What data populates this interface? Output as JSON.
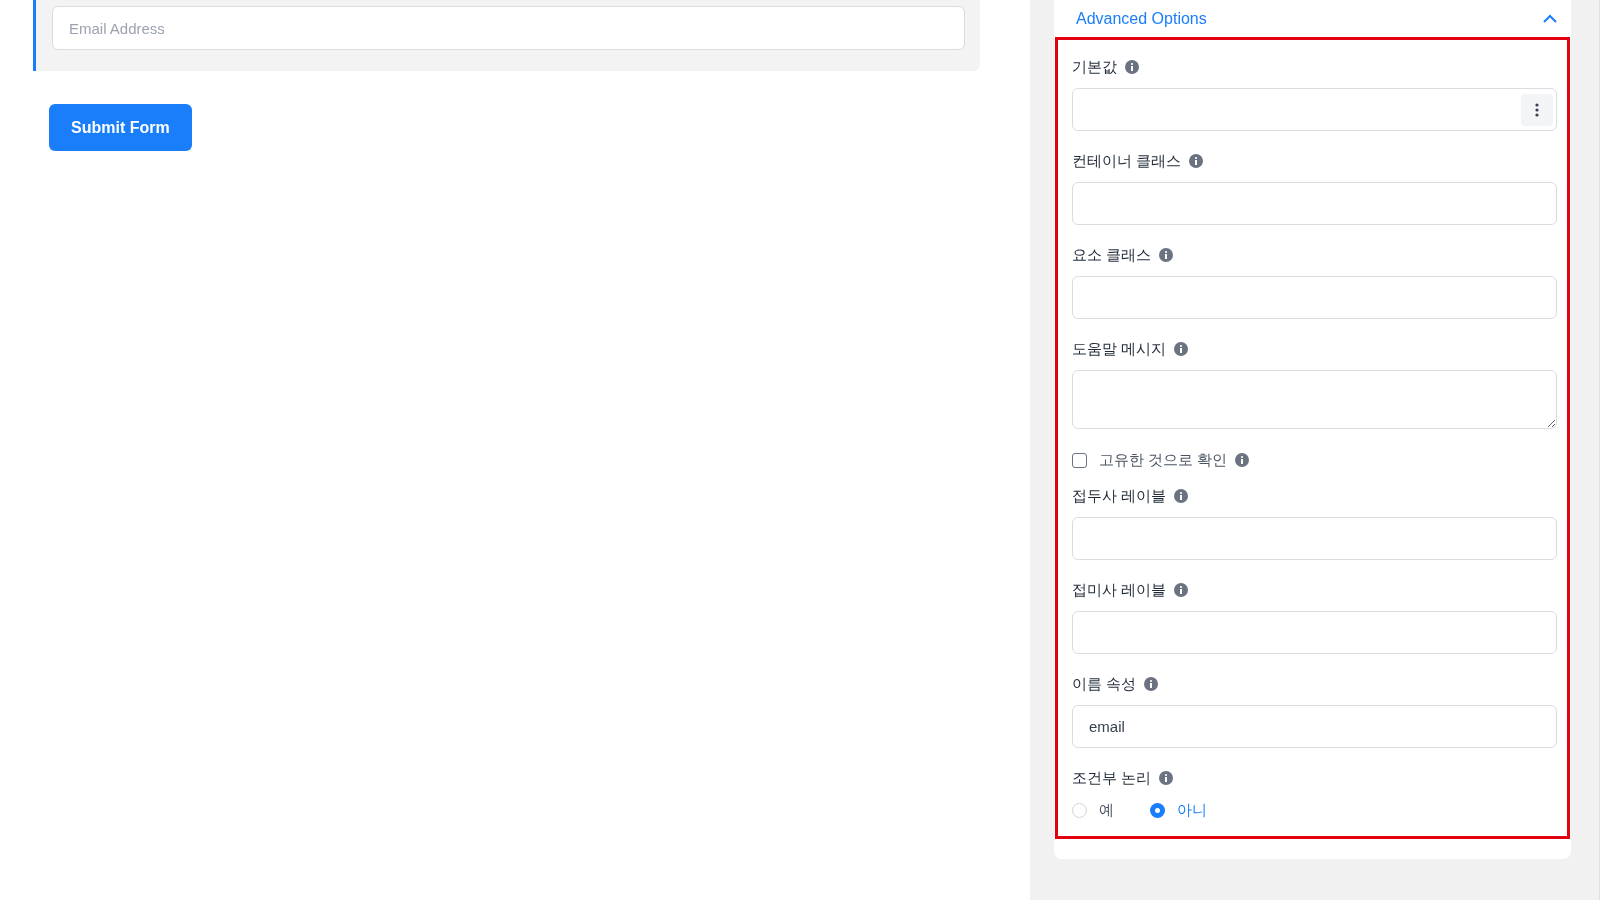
{
  "form": {
    "email_field": {
      "placeholder": "Email Address"
    },
    "submit_button": "Submit Form"
  },
  "advanced_options": {
    "title": "Advanced Options",
    "expanded": true,
    "fields": [
      {
        "kind": "menu-input",
        "label": "기본값"
      },
      {
        "kind": "input",
        "label": "컨테이너 클래스"
      },
      {
        "kind": "input",
        "label": "요소 클래스"
      },
      {
        "kind": "textarea",
        "label": "도움말 메시지"
      },
      {
        "kind": "checkbox",
        "label": "고유한 것으로 확인",
        "checked": false
      },
      {
        "kind": "input",
        "label": "접두사 레이블"
      },
      {
        "kind": "input",
        "label": "접미사 레이블"
      },
      {
        "kind": "input",
        "label": "이름 속성",
        "value": "email"
      },
      {
        "kind": "radio",
        "label": "조건부 논리",
        "options": [
          {
            "label": "예",
            "selected": false
          },
          {
            "label": "아니",
            "selected": true
          }
        ]
      }
    ]
  }
}
